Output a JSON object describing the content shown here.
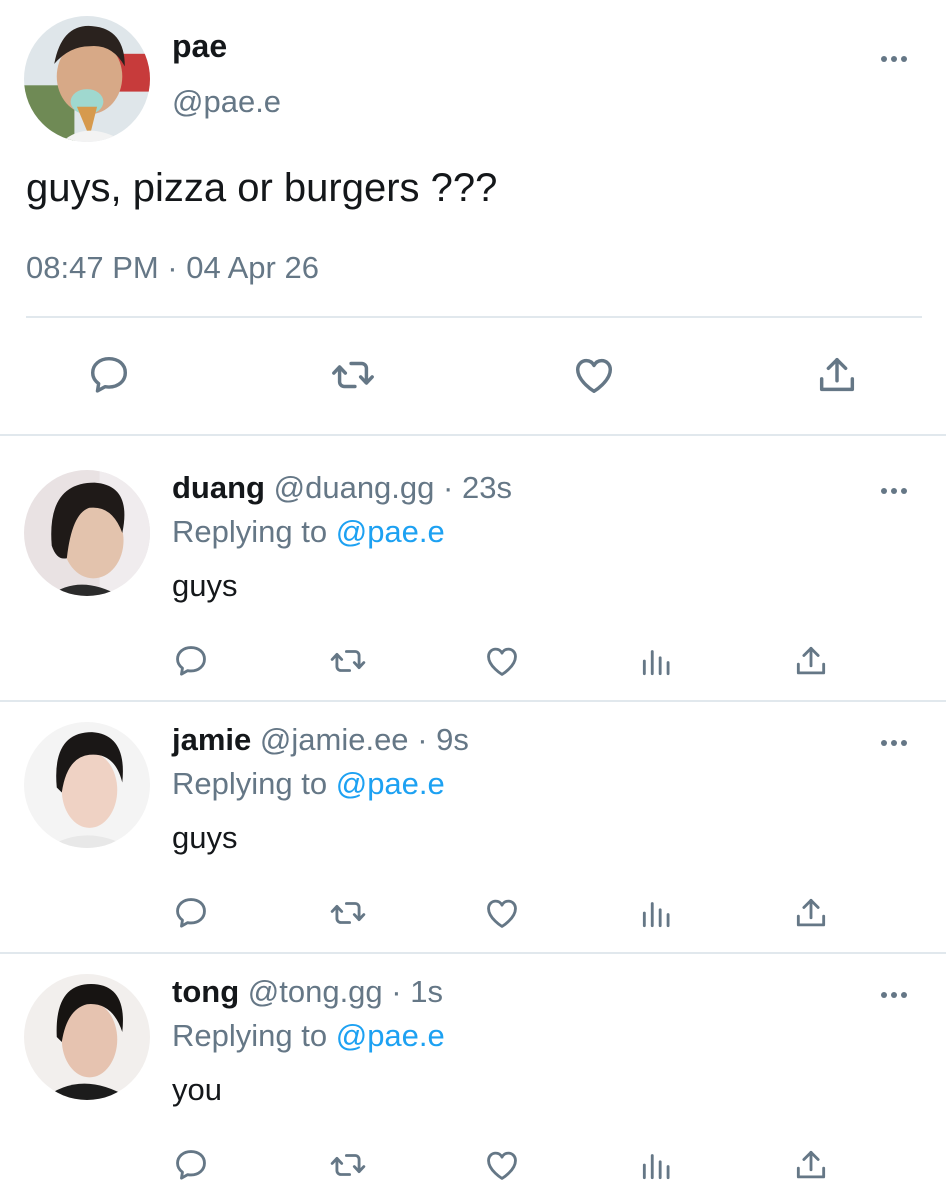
{
  "main_tweet": {
    "display_name": "pae",
    "handle": "@pae.e",
    "text": "guys, pizza or burgers ???",
    "timestamp": "08:47 PM · 04 Apr 26",
    "actions": [
      "comment-icon",
      "retweet-icon",
      "heart-icon",
      "share-icon"
    ]
  },
  "replies": [
    {
      "display_name": "duang",
      "handle": "@duang.gg",
      "time": "· 23s",
      "replying_prefix": "Replying to",
      "replying_to": "@pae.e",
      "text": "guys"
    },
    {
      "display_name": "jamie",
      "handle": "@jamie.ee",
      "time": "· 9s",
      "replying_prefix": "Replying to",
      "replying_to": "@pae.e",
      "text": "guys"
    },
    {
      "display_name": "tong",
      "handle": "@tong.gg",
      "time": "· 1s",
      "replying_prefix": "Replying to",
      "replying_to": "@pae.e",
      "text": "you"
    }
  ],
  "reply_actions": [
    "comment-icon",
    "retweet-icon",
    "heart-icon",
    "analytics-icon",
    "share-icon"
  ],
  "colors": {
    "text_primary": "#14171a",
    "text_secondary": "#657786",
    "link": "#1da1f2",
    "divider": "#e1e8ed",
    "icon": "#657786"
  }
}
